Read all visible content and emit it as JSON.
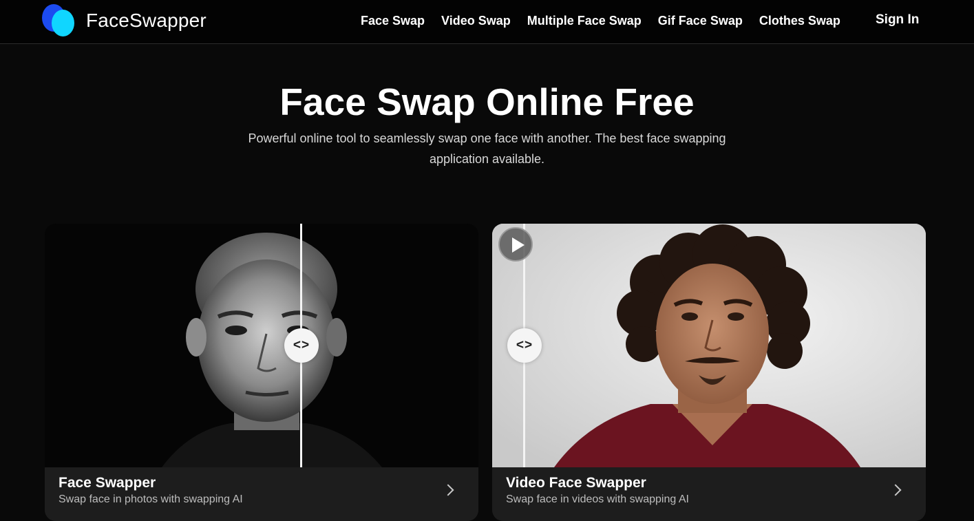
{
  "brand": {
    "name": "FaceSwapper",
    "colors": {
      "primary": "#1c4bf0",
      "secondary": "#10d6ff"
    }
  },
  "nav": {
    "items": [
      {
        "label": "Face Swap"
      },
      {
        "label": "Video Swap"
      },
      {
        "label": "Multiple Face Swap"
      },
      {
        "label": "Gif Face Swap"
      },
      {
        "label": "Clothes Swap"
      }
    ],
    "signin_label": "Sign In"
  },
  "hero": {
    "title": "Face Swap Online Free",
    "subtitle": "Powerful online tool to seamlessly swap one face with another. The best face swapping application available."
  },
  "cards": [
    {
      "title": "Face Swapper",
      "description": "Swap face in photos with swapping AI",
      "compare_handle_icon": "<>",
      "icons": [
        "compare-slider-icon",
        "chevron-right-icon"
      ]
    },
    {
      "title": "Video Face Swapper",
      "description": "Swap face in videos with swapping AI",
      "compare_handle_icon": "<>",
      "icons": [
        "play-icon",
        "compare-slider-icon",
        "chevron-right-icon"
      ]
    }
  ]
}
